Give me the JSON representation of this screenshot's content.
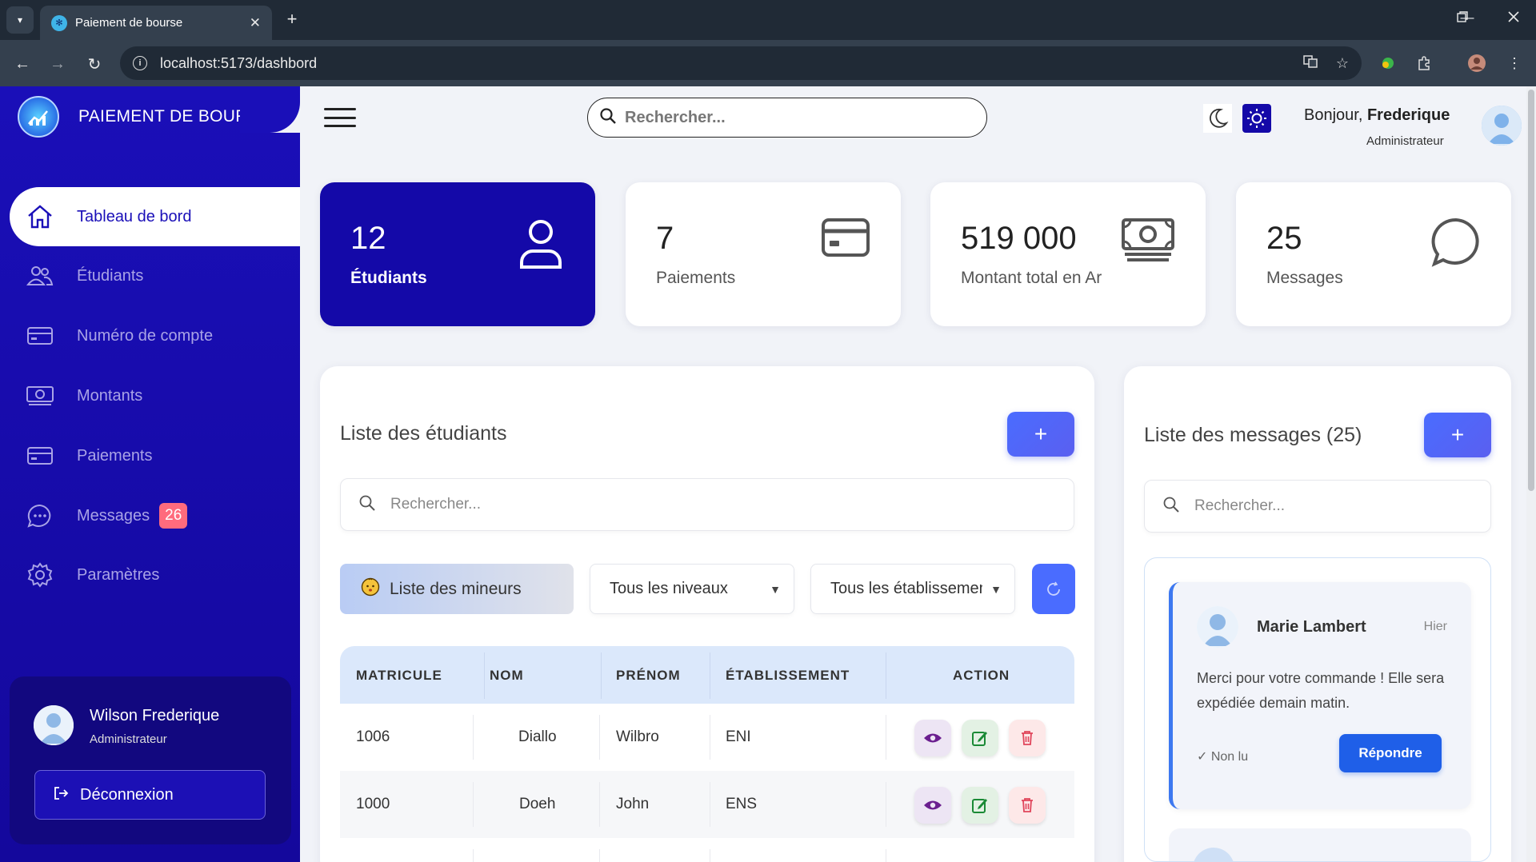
{
  "browser": {
    "tab_title": "Paiement de bourse",
    "url": "localhost:5173/dashbord"
  },
  "sidebar": {
    "brand": "PAIEMENT DE BOURSE",
    "items": [
      {
        "label": "Tableau de bord",
        "icon": "home-icon",
        "active": true
      },
      {
        "label": "Étudiants",
        "icon": "users-icon"
      },
      {
        "label": "Numéro de compte",
        "icon": "credit-card-icon"
      },
      {
        "label": "Montants",
        "icon": "money-icon"
      },
      {
        "label": "Paiements",
        "icon": "credit-card-icon"
      },
      {
        "label": "Messages",
        "icon": "chat-dots-icon",
        "badge": "26"
      },
      {
        "label": "Paramètres",
        "icon": "gear-icon"
      }
    ],
    "user": {
      "name": "Wilson Frederique",
      "role": "Administrateur"
    },
    "logout_label": "Déconnexion"
  },
  "header": {
    "search_placeholder": "Rechercher...",
    "greeting_prefix": "Bonjour,",
    "user_name": "Frederique",
    "user_role": "Administrateur"
  },
  "stats": [
    {
      "value": "12",
      "label": "Étudiants",
      "icon": "user-icon"
    },
    {
      "value": "7",
      "label": "Paiements",
      "icon": "credit-card-icon"
    },
    {
      "value": "519 000",
      "label": "Montant total en Ar",
      "icon": "money-icon"
    },
    {
      "value": "25",
      "label": "Messages",
      "icon": "chat-bubble-icon"
    }
  ],
  "students": {
    "title": "Liste des étudiants",
    "add_label": "+",
    "search_placeholder": "Rechercher...",
    "minors_label": "Liste des mineurs",
    "level_filter": "Tous les niveaux",
    "school_filter": "Tous les établissements",
    "columns": [
      "MATRICULE",
      "NOM",
      "PRÉNOM",
      "ÉTABLISSEMENT",
      "ACTION"
    ],
    "rows": [
      {
        "matricule": "1006",
        "nom": "Diallo",
        "prenom": "Wilbro",
        "etablissement": "ENI"
      },
      {
        "matricule": "1000",
        "nom": "Doeh",
        "prenom": "John",
        "etablissement": "ENS"
      }
    ]
  },
  "messages": {
    "title": "Liste des messages (25)",
    "add_label": "+",
    "search_placeholder": "Rechercher...",
    "items": [
      {
        "sender": "Marie Lambert",
        "date": "Hier",
        "text": "Merci pour votre commande ! Elle sera expédiée demain matin.",
        "status": "✓  Non lu",
        "reply_label": "Répondre"
      }
    ]
  },
  "colors": {
    "sidebar": "#1a0fb8",
    "accent": "#4a6cff",
    "badge": "#ff6b7d",
    "reply": "#1f5fe8"
  }
}
